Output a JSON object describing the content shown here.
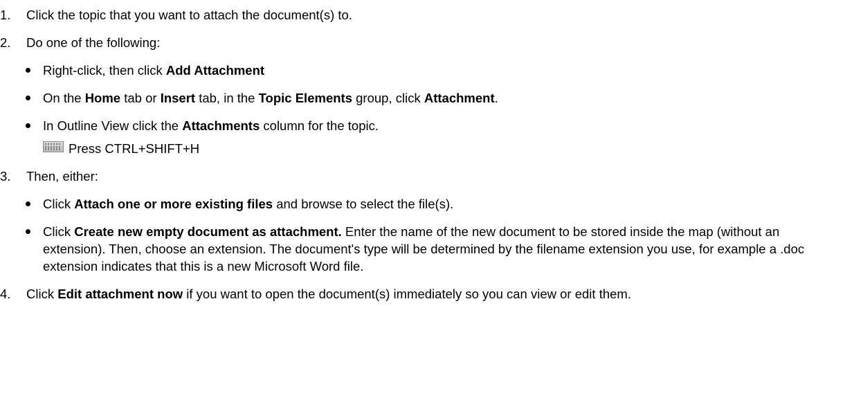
{
  "steps": [
    {
      "number": "1.",
      "text": "Click the topic that you want to attach the document(s) to."
    },
    {
      "number": "2.",
      "text": "Do one of the following:",
      "bullets": [
        {
          "a": "Right-click, then click ",
          "b": "Add Attachment"
        },
        {
          "a": "On the ",
          "b": "Home",
          "c": " tab or ",
          "d": "Insert",
          "e": " tab, in the ",
          "f": "Topic Elements",
          "g": " group, click ",
          "h": "Attachment",
          "i": "."
        },
        {
          "a": "In Outline View click the ",
          "b": "Attachments",
          "c": " column for the topic."
        }
      ],
      "shortcut": {
        "icon": "keyboard-icon",
        "text": "Press CTRL+SHIFT+H"
      }
    },
    {
      "number": "3.",
      "text": "Then, either:",
      "bullets": [
        {
          "a": "Click ",
          "b": "Attach one or more existing files",
          "c": " and browse to select the file(s)."
        },
        {
          "a": "Click ",
          "b": "Create new empty document as attachment.",
          "c": " Enter the name of the new document to be stored inside the map (without an extension). Then, choose an extension. The document's type will be determined by the filename extension you use, for example a .doc extension indicates that this is a new Microsoft Word file."
        }
      ]
    },
    {
      "number": "4.",
      "a": "Click ",
      "b": "Edit attachment now",
      "c": " if you want to open the document(s) immediately so you can view or edit them."
    }
  ]
}
